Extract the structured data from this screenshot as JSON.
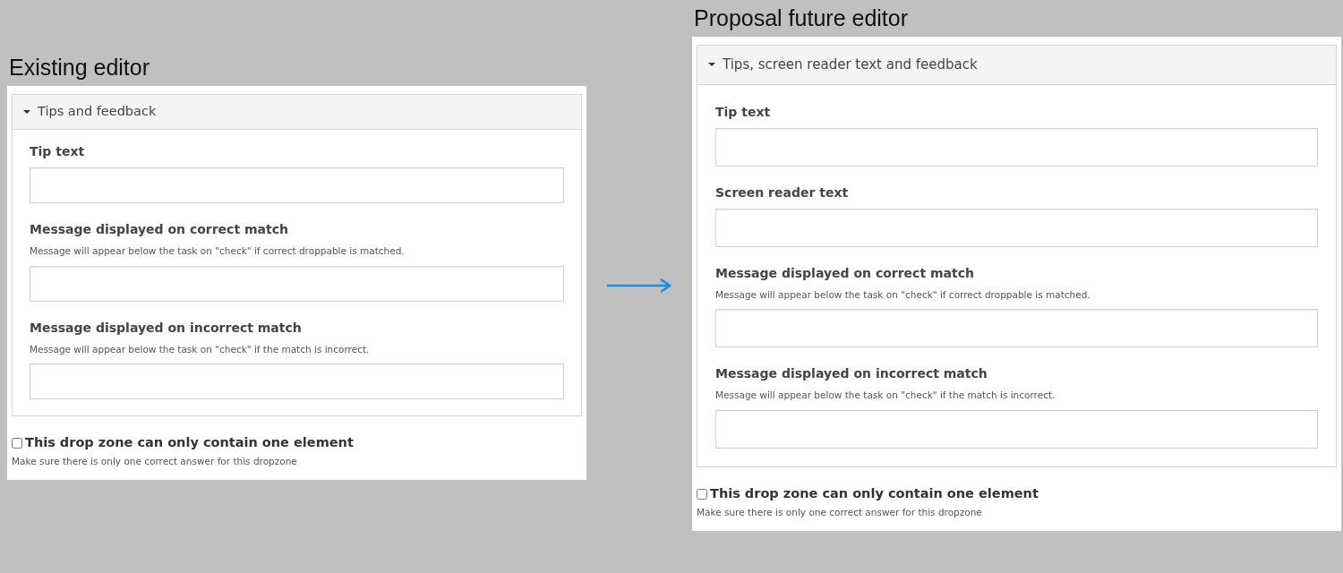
{
  "editors": [
    {
      "heading": "Existing editor",
      "section": {
        "title": "Tips and feedback",
        "expanded": true,
        "fields": [
          {
            "label": "Tip text"
          },
          {
            "label": "Message displayed on correct match",
            "description": "Message will appear below the task on \"check\" if correct droppable is matched."
          },
          {
            "label": "Message displayed on incorrect match",
            "description": "Message will appear below the task on \"check\" if the match is incorrect."
          }
        ]
      },
      "option": {
        "label": "This drop zone can only contain one element",
        "checked": false,
        "description": "Make sure there is only one correct answer for this dropzone"
      }
    },
    {
      "heading": "Proposal future editor",
      "section": {
        "title": "Tips, screen reader text and feedback",
        "expanded": true,
        "fields": [
          {
            "label": "Tip text"
          },
          {
            "label": "Screen reader text"
          },
          {
            "label": "Message displayed on correct match",
            "description": "Message will appear below the task on \"check\" if correct droppable is matched."
          },
          {
            "label": "Message displayed on incorrect match",
            "description": "Message will appear below the task on \"check\" if the match is incorrect."
          }
        ]
      },
      "option": {
        "label": "This drop zone can only contain one element",
        "checked": false,
        "description": "Make sure there is only one correct answer for this dropzone"
      }
    }
  ]
}
